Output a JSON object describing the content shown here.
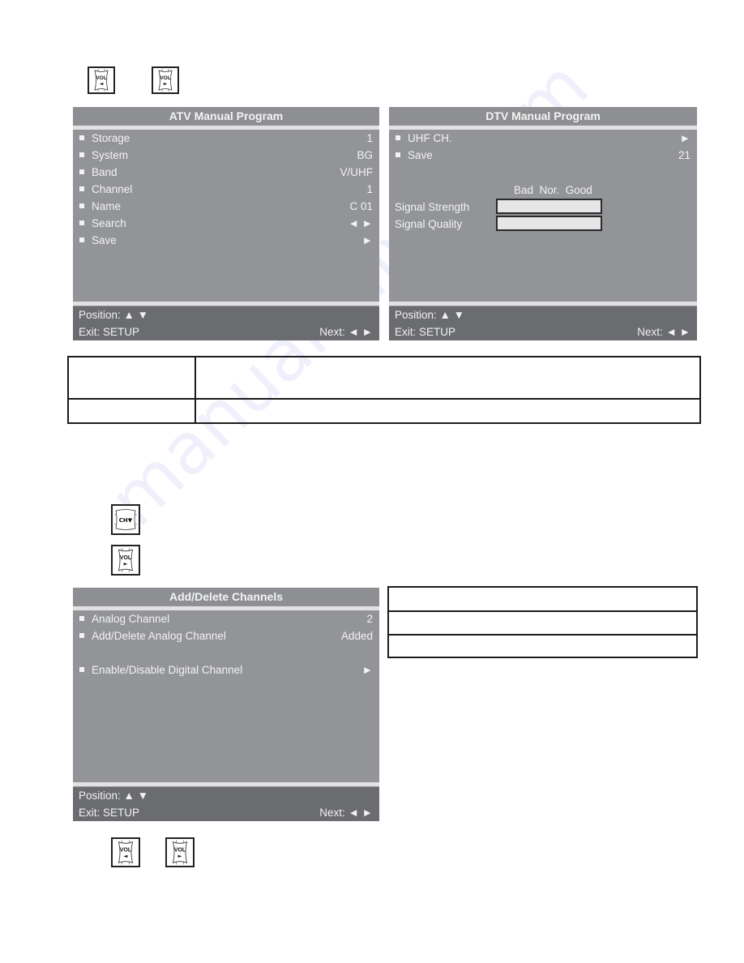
{
  "top_buttons": [
    {
      "label": "VOL",
      "arrow": "◄",
      "icon": "vol-left-icon"
    },
    {
      "label": "VOL",
      "arrow": "►",
      "icon": "vol-right-icon"
    }
  ],
  "atv_panel": {
    "title": "ATV Manual Program",
    "items": [
      {
        "label": "Storage",
        "value": "1"
      },
      {
        "label": "System",
        "value": "BG"
      },
      {
        "label": "Band",
        "value": "V/UHF"
      },
      {
        "label": "Channel",
        "value": "1"
      },
      {
        "label": "Name",
        "value": "C 01"
      },
      {
        "label": "Search",
        "value": "◄ ►"
      },
      {
        "label": "Save",
        "value": "►"
      }
    ],
    "footer": {
      "position": "Position: ▲ ▼",
      "exit": "Exit: SETUP",
      "next": "Next: ◄ ►"
    }
  },
  "dtv_panel": {
    "title": "DTV Manual Program",
    "items": [
      {
        "label": "UHF CH.",
        "value": "►"
      },
      {
        "label": "Save",
        "value": "21"
      }
    ],
    "signal_scale": "Bad  Nor.  Good",
    "signal_strength_label": "Signal Strength",
    "signal_quality_label": "Signal Quality",
    "footer": {
      "position": "Position: ▲ ▼",
      "exit": "Exit: SETUP",
      "next": "Next: ◄ ►"
    }
  },
  "info_table": {
    "rows": [
      [
        "",
        ""
      ],
      [
        "",
        ""
      ]
    ]
  },
  "middle_buttons": [
    {
      "label": "CH▼",
      "icon": "ch-down-icon"
    },
    {
      "label": "VOL",
      "arrow": "►",
      "icon": "vol-right-icon"
    }
  ],
  "add_delete_panel": {
    "title": "Add/Delete Channels",
    "items": [
      {
        "label": "Analog Channel",
        "value": "2"
      },
      {
        "label": "Add/Delete Analog Channel",
        "value": "Added"
      },
      {
        "label": "Enable/Disable Digital Channel",
        "value": "►"
      }
    ],
    "footer": {
      "position": "Position: ▲ ▼",
      "exit": "Exit: SETUP",
      "next": "Next: ◄ ►"
    }
  },
  "side_table": {
    "rows": [
      [
        ""
      ],
      [
        ""
      ],
      [
        ""
      ]
    ]
  },
  "bottom_buttons": [
    {
      "label": "VOL",
      "arrow": "◄",
      "icon": "vol-left-icon"
    },
    {
      "label": "VOL",
      "arrow": "►",
      "icon": "vol-right-icon"
    }
  ],
  "watermark": "manualshive.com"
}
